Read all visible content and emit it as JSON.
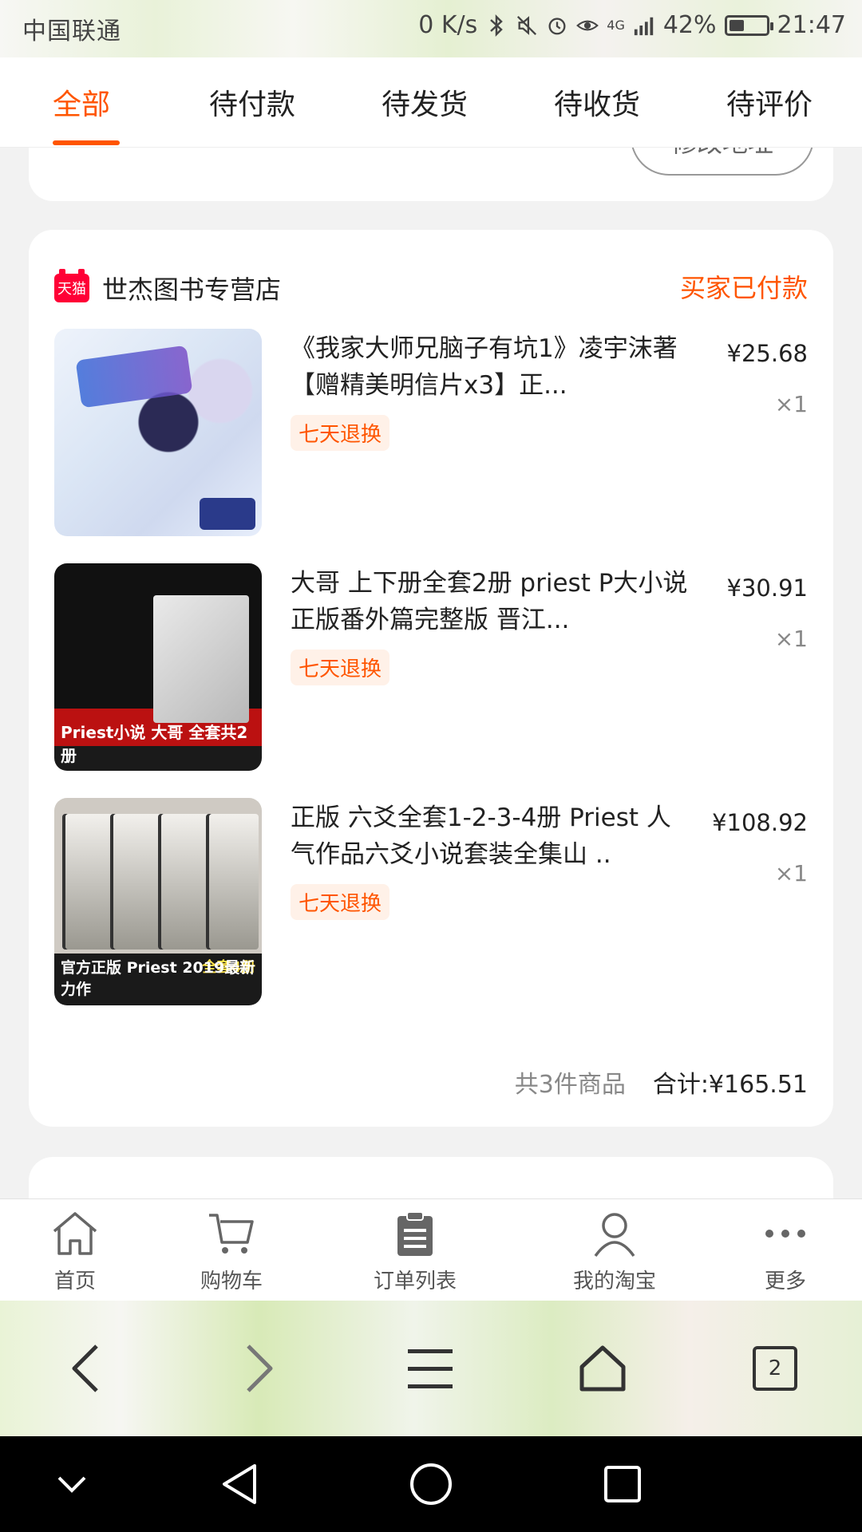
{
  "status_bar": {
    "carrier": "中国联通",
    "speed": "0 K/s",
    "network": "4G",
    "battery_percent": "42%",
    "battery_level": 0.42,
    "time": "21:47"
  },
  "tabs": [
    {
      "label": "全部",
      "active": true
    },
    {
      "label": "待付款",
      "active": false
    },
    {
      "label": "待发货",
      "active": false
    },
    {
      "label": "待收货",
      "active": false
    },
    {
      "label": "待评价",
      "active": false
    }
  ],
  "previous_card": {
    "button_label": "修改地址"
  },
  "order": {
    "shop_badge": "天猫",
    "shop_name": "世杰图书专营店",
    "status": "买家已付款",
    "items": [
      {
        "title": "《我家大师兄脑子有坑1》凌宇沫著【赠精美明信片x3】正...",
        "tag": "七天退换",
        "price": "¥25.68",
        "qty": "×1"
      },
      {
        "title": "大哥 上下册全套2册 priest P大小说正版番外篇完整版 晋江...",
        "tag": "七天退换",
        "price": "¥30.91",
        "qty": "×1",
        "thumb_caption": "Priest小说 大哥 全套共2册"
      },
      {
        "title": "正版 六爻全套1-2-3-4册 Priest 人气作品六爻小说套装全集山 ..",
        "tag": "七天退换",
        "price": "¥108.92",
        "qty": "×1",
        "thumb_caption": "官方正版 Priest 2019最新力作",
        "thumb_caption2": "全套4册"
      }
    ],
    "summary_count": "共3件商品",
    "summary_total": "合计:¥165.51"
  },
  "bottom_nav": [
    {
      "label": "首页",
      "icon": "home-icon"
    },
    {
      "label": "购物车",
      "icon": "cart-icon"
    },
    {
      "label": "订单列表",
      "icon": "order-list-icon"
    },
    {
      "label": "我的淘宝",
      "icon": "user-icon"
    },
    {
      "label": "更多",
      "icon": "more-icon"
    }
  ],
  "browser_toolbar": {
    "tabs_count": "2"
  },
  "colors": {
    "accent": "#ff5500",
    "tmall_red": "#ff0036",
    "background": "#f2f2f2"
  }
}
